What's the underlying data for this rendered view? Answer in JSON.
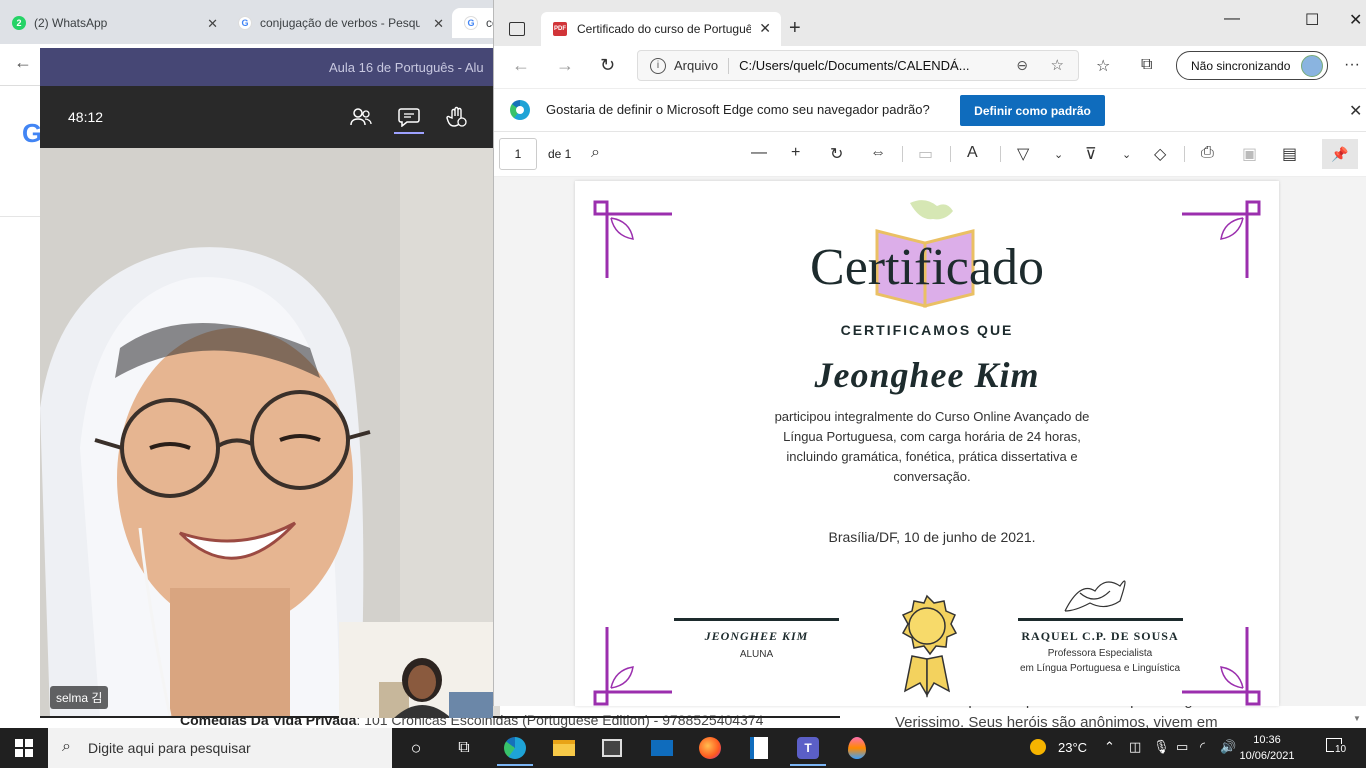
{
  "background_browser": {
    "tabs": [
      {
        "icon": "whatsapp-icon",
        "label": "(2) WhatsApp"
      },
      {
        "icon": "google-icon",
        "label": "conjugação de verbos - Pesquisa"
      },
      {
        "icon": "google-icon",
        "label": "co"
      }
    ],
    "footer_title": "Comédias Da Vida Privada",
    "footer_rest": ": 101 Crônicas Escolhidas (Portuguese Edition) - 9788525404374",
    "right_text": "denso e impreciso que circulam os personagens de Verissimo. Seus heróis são anônimos, vivem em"
  },
  "teams": {
    "title": "Aula 16 de Português - Alu",
    "timer": "48:12",
    "participant_name": "selma 김"
  },
  "edge": {
    "tab_title": "Certificado do curso de Português",
    "address_label": "Arquivo",
    "address_url": "C:/Users/quelc/Documents/CALENDÁ...",
    "sync_label": "Não sincronizando",
    "infobar_text": "Gostaria de definir o Microsoft Edge como seu navegador padrão?",
    "infobar_button": "Definir como padrão",
    "page_number": "1",
    "page_of": "de 1"
  },
  "certificate": {
    "title": "Certificado",
    "subtitle": "CERTIFICAMOS QUE",
    "name": "Jeonghee Kim",
    "body": "participou integralmente do Curso Online Avançado de Língua Portuguesa, com carga horária de 24 horas, incluindo gramática, fonética, prática dissertativa e conversação.",
    "date": "Brasília/DF, 10 de junho de 2021.",
    "student_name": "JEONGHEE KIM",
    "student_role": "ALUNA",
    "teacher_name": "RAQUEL C.P. DE SOUSA",
    "teacher_role_1": "Professora Especialista",
    "teacher_role_2": "em Língua Portuguesa e Linguística",
    "accent_color": "#9b2fae"
  },
  "taskbar": {
    "search_placeholder": "Digite aqui para pesquisar",
    "temperature": "23°C",
    "time": "10:36",
    "date": "10/06/2021",
    "notifications": "10"
  }
}
